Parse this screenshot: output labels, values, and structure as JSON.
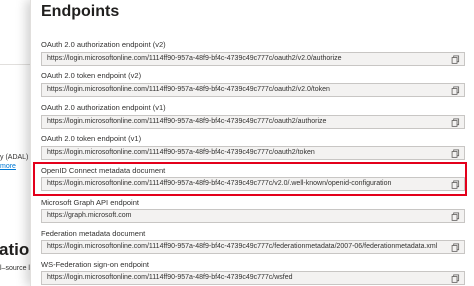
{
  "background": {
    "adal_text": "y (ADAL) a",
    "more_link": "more",
    "heading": "ation v",
    "subtext": "l–source li"
  },
  "panel": {
    "title": "Endpoints",
    "endpoints": [
      {
        "label": "OAuth 2.0 authorization endpoint (v2)",
        "value": "https://login.microsoftonline.com/1114ff90-957a-48f9-bf4c-4739c49c777c/oauth2/v2.0/authorize"
      },
      {
        "label": "OAuth 2.0 token endpoint (v2)",
        "value": "https://login.microsoftonline.com/1114ff90-957a-48f9-bf4c-4739c49c777c/oauth2/v2.0/token"
      },
      {
        "label": "OAuth 2.0 authorization endpoint (v1)",
        "value": "https://login.microsoftonline.com/1114ff90-957a-48f9-bf4c-4739c49c777c/oauth2/authorize"
      },
      {
        "label": "OAuth 2.0 token endpoint (v1)",
        "value": "https://login.microsoftonline.com/1114ff90-957a-48f9-bf4c-4739c49c777c/oauth2/token"
      },
      {
        "label": "OpenID Connect metadata document",
        "value": "https://login.microsoftonline.com/1114ff90-957a-48f9-bf4c-4739c49c777c/v2.0/.well-known/openid-configuration"
      },
      {
        "label": "Microsoft Graph API endpoint",
        "value": "https://graph.microsoft.com"
      },
      {
        "label": "Federation metadata document",
        "value": "https://login.microsoftonline.com/1114ff90-957a-48f9-bf4c-4739c49c777c/federationmetadata/2007-06/federationmetadata.xml"
      },
      {
        "label": "WS-Federation sign-on endpoint",
        "value": "https://login.microsoftonline.com/1114ff90-957a-48f9-bf4c-4739c49c777c/wsfed"
      }
    ]
  },
  "highlight_color": "#e3001b",
  "copy_icon": "copy-icon"
}
